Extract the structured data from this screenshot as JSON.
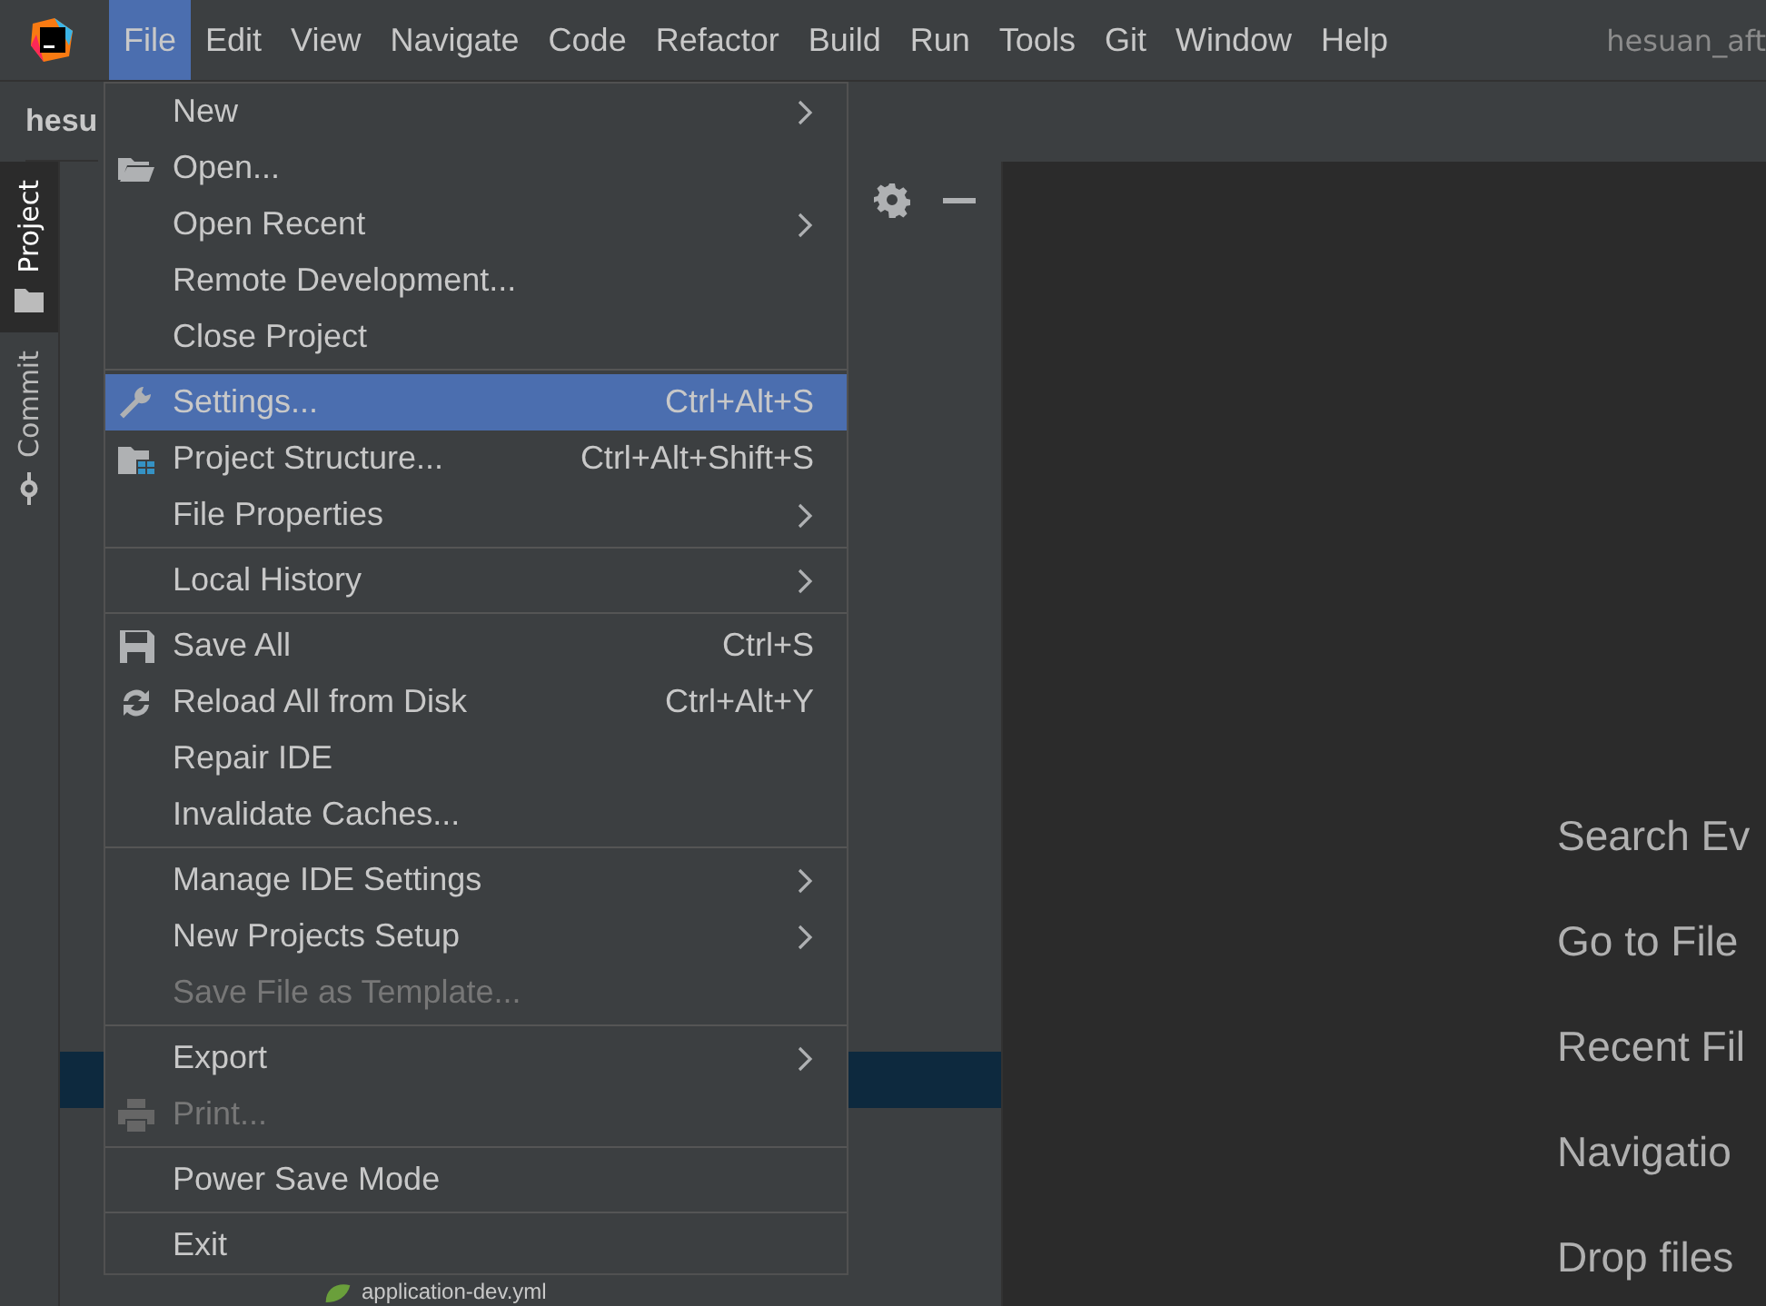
{
  "menubar": {
    "items": [
      {
        "label": "File",
        "selected": true
      },
      {
        "label": "Edit",
        "selected": false
      },
      {
        "label": "View",
        "selected": false
      },
      {
        "label": "Navigate",
        "selected": false
      },
      {
        "label": "Code",
        "selected": false
      },
      {
        "label": "Refactor",
        "selected": false
      },
      {
        "label": "Build",
        "selected": false
      },
      {
        "label": "Run",
        "selected": false
      },
      {
        "label": "Tools",
        "selected": false
      },
      {
        "label": "Git",
        "selected": false
      },
      {
        "label": "Window",
        "selected": false
      },
      {
        "label": "Help",
        "selected": false
      }
    ],
    "title": "hesuan_aft"
  },
  "breadcrumb": "hesu",
  "tool_strip": [
    {
      "label": "Project",
      "kind": "folder",
      "selected": true
    },
    {
      "label": "Commit",
      "kind": "commit",
      "selected": false
    }
  ],
  "project_tree": {
    "rows": [
      {
        "label": "application-dev.yml",
        "selected": false
      }
    ]
  },
  "file_menu": [
    {
      "kind": "plain",
      "label": "New",
      "submenu": true,
      "disabled": false,
      "selected": false
    },
    {
      "kind": "folder",
      "label": "Open...",
      "submenu": false,
      "disabled": false,
      "selected": false
    },
    {
      "kind": "plain",
      "label": "Open Recent",
      "submenu": true,
      "disabled": false,
      "selected": false
    },
    {
      "kind": "plain",
      "label": "Remote Development...",
      "submenu": false,
      "disabled": false,
      "selected": false
    },
    {
      "kind": "plain",
      "label": "Close Project",
      "submenu": false,
      "disabled": false,
      "selected": false
    },
    {
      "kind": "separator"
    },
    {
      "kind": "wrench",
      "label": "Settings...",
      "shortcut": "Ctrl+Alt+S",
      "submenu": false,
      "disabled": false,
      "selected": true
    },
    {
      "kind": "structure",
      "label": "Project Structure...",
      "shortcut": "Ctrl+Alt+Shift+S",
      "submenu": false,
      "disabled": false,
      "selected": false
    },
    {
      "kind": "plain",
      "label": "File Properties",
      "submenu": true,
      "disabled": false,
      "selected": false
    },
    {
      "kind": "separator"
    },
    {
      "kind": "plain",
      "label": "Local History",
      "submenu": true,
      "disabled": false,
      "selected": false
    },
    {
      "kind": "separator"
    },
    {
      "kind": "save",
      "label": "Save All",
      "shortcut": "Ctrl+S",
      "submenu": false,
      "disabled": false,
      "selected": false
    },
    {
      "kind": "reload",
      "label": "Reload All from Disk",
      "shortcut": "Ctrl+Alt+Y",
      "submenu": false,
      "disabled": false,
      "selected": false
    },
    {
      "kind": "plain",
      "label": "Repair IDE",
      "submenu": false,
      "disabled": false,
      "selected": false
    },
    {
      "kind": "plain",
      "label": "Invalidate Caches...",
      "submenu": false,
      "disabled": false,
      "selected": false
    },
    {
      "kind": "separator"
    },
    {
      "kind": "plain",
      "label": "Manage IDE Settings",
      "submenu": true,
      "disabled": false,
      "selected": false
    },
    {
      "kind": "plain",
      "label": "New Projects Setup",
      "submenu": true,
      "disabled": false,
      "selected": false
    },
    {
      "kind": "plain",
      "label": "Save File as Template...",
      "submenu": false,
      "disabled": true,
      "selected": false
    },
    {
      "kind": "separator"
    },
    {
      "kind": "plain",
      "label": "Export",
      "submenu": true,
      "disabled": false,
      "selected": false
    },
    {
      "kind": "printer",
      "label": "Print...",
      "submenu": false,
      "disabled": true,
      "selected": false
    },
    {
      "kind": "separator"
    },
    {
      "kind": "plain",
      "label": "Power Save Mode",
      "submenu": false,
      "disabled": false,
      "selected": false
    },
    {
      "kind": "separator"
    },
    {
      "kind": "plain",
      "label": "Exit",
      "submenu": false,
      "disabled": false,
      "selected": false
    }
  ],
  "editor_hints": [
    "Search Ev",
    "Go to File",
    "Recent Fil",
    "Navigatio",
    "Drop files"
  ]
}
